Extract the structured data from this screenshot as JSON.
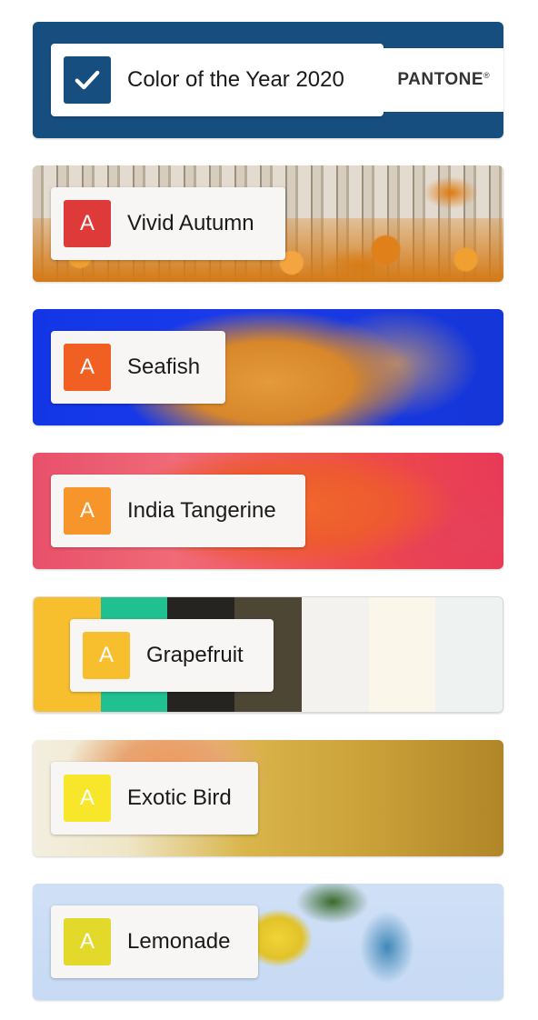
{
  "brand": {
    "name": "PANTONE",
    "mark": "®"
  },
  "cards": [
    {
      "label": "Color of the Year 2020",
      "swatch_color": "#174e80",
      "swatch_icon": "check-icon",
      "selected": true
    },
    {
      "label": "Vivid Autumn",
      "swatch_color": "#de3a3a",
      "swatch_letter": "A"
    },
    {
      "label": "Seafish",
      "swatch_color": "#f25f22",
      "swatch_letter": "A"
    },
    {
      "label": "India Tangerine",
      "swatch_color": "#f7942a",
      "swatch_letter": "A"
    },
    {
      "label": "Grapefruit",
      "swatch_color": "#f7be2e",
      "swatch_letter": "A",
      "palette": [
        "#f7be2e",
        "#20c090",
        "#252421",
        "#4e4635",
        "#f4f2ee",
        "#fbf6ea",
        "#eef2f0"
      ]
    },
    {
      "label": "Exotic Bird",
      "swatch_color": "#f8e62a",
      "swatch_letter": "A"
    },
    {
      "label": "Lemonade",
      "swatch_color": "#e3d92a",
      "swatch_letter": "A"
    }
  ]
}
